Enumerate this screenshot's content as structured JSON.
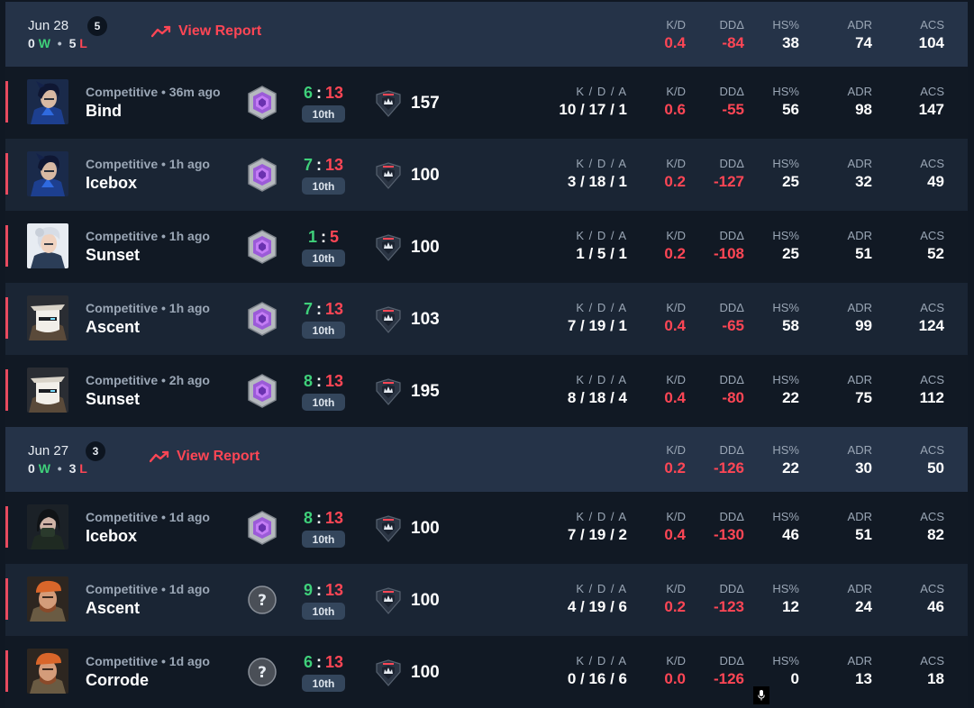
{
  "stat_labels": {
    "kda": "K / D / A",
    "kd": "K/D",
    "dd": "DDΔ",
    "hs": "HS%",
    "adr": "ADR",
    "acs": "ACS"
  },
  "days": [
    {
      "date": "Jun 28",
      "count": "5",
      "wins": "0",
      "win_letter": "W",
      "losses": "5",
      "loss_letter": "L",
      "view_report": "View Report",
      "summary": {
        "kd": "0.4",
        "dd": "-84",
        "hs": "38",
        "adr": "74",
        "acs": "104"
      },
      "matches": [
        {
          "agent": "yoru-portrait",
          "mode": "Competitive • 36m ago",
          "map": "Bind",
          "rank_icon": "rank-gem-icon",
          "score_won": "6",
          "score_lost": "13",
          "placement": "10th",
          "rr": "157",
          "kda": "10 / 17 / 1",
          "kd": "0.6",
          "dd": "-55",
          "hs": "56",
          "adr": "98",
          "acs": "147"
        },
        {
          "agent": "yoru-portrait",
          "mode": "Competitive • 1h ago",
          "map": "Icebox",
          "rank_icon": "rank-gem-icon",
          "score_won": "7",
          "score_lost": "13",
          "placement": "10th",
          "rr": "100",
          "kda": "3 / 18 / 1",
          "kd": "0.2",
          "dd": "-127",
          "hs": "25",
          "adr": "32",
          "acs": "49"
        },
        {
          "agent": "jett-portrait",
          "mode": "Competitive • 1h ago",
          "map": "Sunset",
          "rank_icon": "rank-gem-icon",
          "score_won": "1",
          "score_lost": "5",
          "placement": "10th",
          "rr": "100",
          "kda": "1 / 5 / 1",
          "kd": "0.2",
          "dd": "-108",
          "hs": "25",
          "adr": "51",
          "acs": "52"
        },
        {
          "agent": "cypher-portrait",
          "mode": "Competitive • 1h ago",
          "map": "Ascent",
          "rank_icon": "rank-gem-icon",
          "score_won": "7",
          "score_lost": "13",
          "placement": "10th",
          "rr": "103",
          "kda": "7 / 19 / 1",
          "kd": "0.4",
          "dd": "-65",
          "hs": "58",
          "adr": "99",
          "acs": "124"
        },
        {
          "agent": "cypher-portrait",
          "mode": "Competitive • 2h ago",
          "map": "Sunset",
          "rank_icon": "rank-gem-icon",
          "score_won": "8",
          "score_lost": "13",
          "placement": "10th",
          "rr": "195",
          "kda": "8 / 18 / 4",
          "kd": "0.4",
          "dd": "-80",
          "hs": "22",
          "adr": "75",
          "acs": "112"
        }
      ]
    },
    {
      "date": "Jun 27",
      "count": "3",
      "wins": "0",
      "win_letter": "W",
      "losses": "3",
      "loss_letter": "L",
      "view_report": "View Report",
      "summary": {
        "kd": "0.2",
        "dd": "-126",
        "hs": "22",
        "adr": "30",
        "acs": "50"
      },
      "matches": [
        {
          "agent": "viper-portrait",
          "mode": "Competitive • 1d ago",
          "map": "Icebox",
          "rank_icon": "rank-gem-icon",
          "score_won": "8",
          "score_lost": "13",
          "placement": "10th",
          "rr": "100",
          "kda": "7 / 19 / 2",
          "kd": "0.4",
          "dd": "-130",
          "hs": "46",
          "adr": "51",
          "acs": "82"
        },
        {
          "agent": "brimstone-portrait",
          "mode": "Competitive • 1d ago",
          "map": "Ascent",
          "rank_icon": "unranked-question-icon",
          "score_won": "9",
          "score_lost": "13",
          "placement": "10th",
          "rr": "100",
          "kda": "4 / 19 / 6",
          "kd": "0.2",
          "dd": "-123",
          "hs": "12",
          "adr": "24",
          "acs": "46"
        },
        {
          "agent": "brimstone-portrait",
          "mode": "Competitive • 1d ago",
          "map": "Corrode",
          "rank_icon": "unranked-question-icon",
          "score_won": "6",
          "score_lost": "13",
          "placement": "10th",
          "rr": "100",
          "kda": "0 / 16 / 6",
          "kd": "0.0",
          "dd": "-126",
          "hs": "0",
          "adr": "13",
          "acs": "18"
        }
      ]
    }
  ],
  "colors": {
    "win": "#3fd07a",
    "loss": "#ff4655",
    "header_bg": "#253348",
    "row_dark": "#111924",
    "row_light": "#1a2534"
  }
}
